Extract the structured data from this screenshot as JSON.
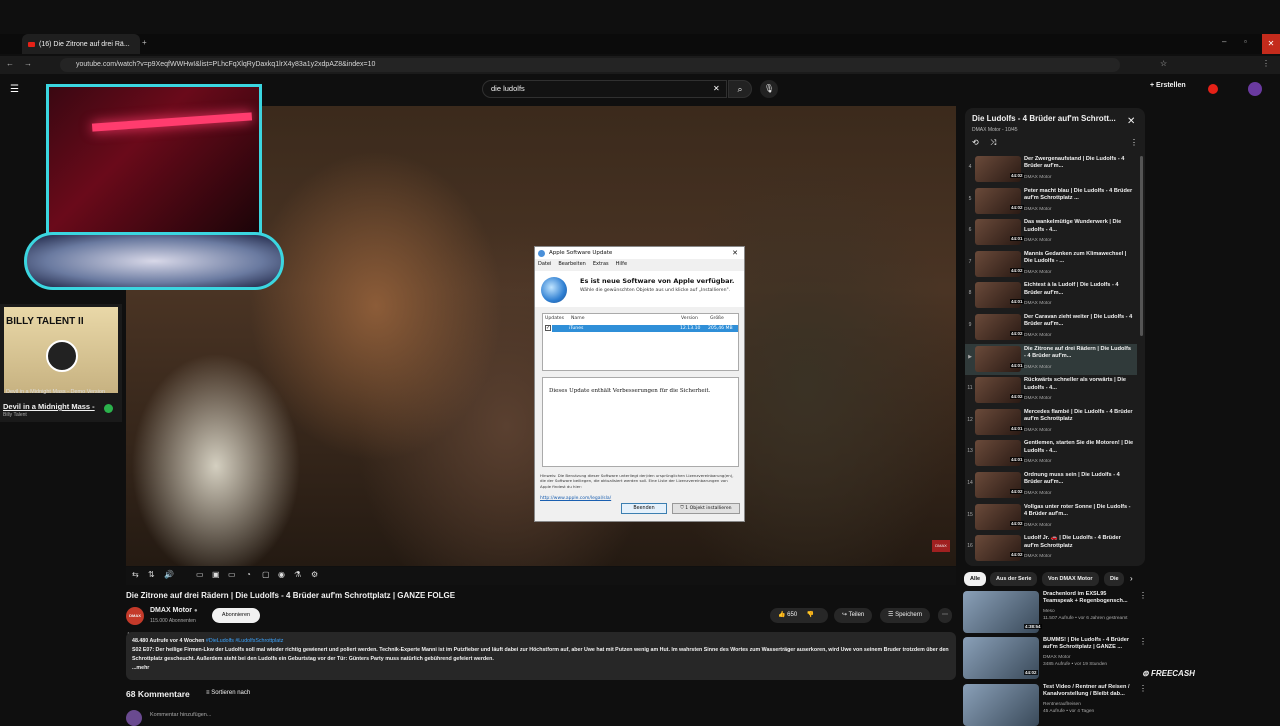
{
  "browser": {
    "tab_title": "(16) Die Zitrone auf drei Rä...",
    "url": "youtube.com/watch?v=p9XeqfWWHwI&list=PLhcFqXlqRyDaxkq1lrX4y83a1y2xdpAZ8&index=10"
  },
  "header": {
    "search_value": "die ludolfs",
    "create_label": "Erstellen"
  },
  "album": {
    "art_title": "BILLY TALENT II",
    "caption": "Devil in a Midnight Mass - Demo Version",
    "song": "Devil in a Midnight Mass -",
    "artist": "Billy Talent"
  },
  "dialog": {
    "title": "Apple Software Update",
    "menu": [
      "Datei",
      "Bearbeiten",
      "Extras",
      "Hilfe"
    ],
    "heading": "Es ist neue Software von Apple verfügbar.",
    "subheading": "Wähle die gewünschten Objekte aus und klicke auf „Installieren\".",
    "col_updates": "Updates",
    "col_name": "Name",
    "col_version": "Version",
    "col_size": "Größe",
    "item_name": "iTunes",
    "item_version": "12.13.10",
    "item_size": "205,46 MB",
    "description": "Dieses Update enthält Verbesserungen für die Sicherheit.",
    "fineprint": "Hinweis: Die Benutzung dieser Software unterliegt der/den ursprünglichen Lizenzvereinbarung(en), die der Software beiliegen, die aktualisiert werden soll. Eine Liste der Lizenzvereinbarungen von Apple findest du hier:",
    "link": "http://www.apple.com/legal/sla/",
    "quit_label": "Beenden",
    "install_label": "1 Objekt installieren"
  },
  "video": {
    "title": "Die Zitrone auf drei Rädern | Die Ludolfs - 4 Brüder auf'm Schrottplatz | GANZE FOLGE",
    "channel": "DMAX Motor",
    "subscribers": "115.000 Abonnenten",
    "subscribe_label": "Abonnieren",
    "avatar_text": "DMAX MOTOR",
    "likes": "650",
    "share_label": "Teilen",
    "save_label": "Speichern",
    "desc_meta": "48.480 Aufrufe  vor 4 Wochen",
    "desc_tags": "#DieLudolfs #LudolfsSchrottplatz",
    "desc_text": "S02 E07: Der heilige Firmen-Lkw der Ludolfs soll mal wieder richtig gewienert und poliert werden. Technik-Experte Manni ist im Putzfieber und läuft dabei zur Höchstform auf, aber Uwe hat mit Putzen wenig am Hut. Im wahrsten Sinne des Wortes zum Wasserträger auserkoren, wird Uwe von seinem Bruder trotzdem über den Schrottplatz gescheucht. Außerdem steht bei den Ludolfs ein Geburtstag vor der Tür: Günters Party muss natürlich gebührend gefeiert werden.",
    "desc_more": "...mehr",
    "comments_count": "68 Kommentare",
    "sort_label": "Sortieren nach",
    "add_comment": "Kommentar hinzufügen..."
  },
  "playlist": {
    "title": "Die Ludolfs - 4 Brüder auf'm Schrott...",
    "subtitle": "DMAX Motor - 10/45",
    "items": [
      {
        "num": "4",
        "title": "Der Zwergenaufstand | Die Ludolfs - 4 Brüder auf'm...",
        "channel": "DMAX Motor",
        "duration": "44:02"
      },
      {
        "num": "5",
        "title": "Peter macht blau | Die Ludolfs - 4 Brüder auf'm Schrottplatz ...",
        "channel": "DMAX Motor",
        "duration": "44:02"
      },
      {
        "num": "6",
        "title": "Das wankelmütige Wunderwerk | Die Ludolfs - 4...",
        "channel": "DMAX Motor",
        "duration": "44:01"
      },
      {
        "num": "7",
        "title": "Mannis Gedanken zum Klimawechsel | Die Ludolfs - ...",
        "channel": "DMAX Motor",
        "duration": "44:02"
      },
      {
        "num": "8",
        "title": "Eichtest à la Ludolf | Die Ludolfs - 4 Brüder auf'm...",
        "channel": "DMAX Motor",
        "duration": "44:01"
      },
      {
        "num": "9",
        "title": "Der Caravan zieht weiter | Die Ludolfs - 4 Brüder auf'm...",
        "channel": "DMAX Motor",
        "duration": "44:02"
      },
      {
        "num": "▶",
        "title": "Die Zitrone auf drei Rädern | Die Ludolfs - 4 Brüder auf'm...",
        "channel": "DMAX Motor",
        "duration": "44:01"
      },
      {
        "num": "11",
        "title": "Rückwärts schneller als vorwärts | Die Ludolfs - 4...",
        "channel": "DMAX Motor",
        "duration": "44:02"
      },
      {
        "num": "12",
        "title": "Mercedes flambé | Die Ludolfs - 4 Brüder auf'm Schrottplatz",
        "channel": "DMAX Motor",
        "duration": "44:01"
      },
      {
        "num": "13",
        "title": "Gentlemen, starten Sie die Motoren! | Die Ludolfs - 4...",
        "channel": "DMAX Motor",
        "duration": "44:01"
      },
      {
        "num": "14",
        "title": "Ordnung muss sein | Die Ludolfs - 4 Brüder auf'm...",
        "channel": "DMAX Motor",
        "duration": "44:02"
      },
      {
        "num": "15",
        "title": "Vollgas unter roter Sonne | Die Ludolfs - 4 Brüder auf'm...",
        "channel": "DMAX Motor",
        "duration": "44:02"
      },
      {
        "num": "16",
        "title": "Ludolf Jr. 🚗 | Die Ludolfs - 4 Brüder auf'm Schrottplatz",
        "channel": "DMAX Motor",
        "duration": "44:02"
      }
    ]
  },
  "chips": [
    "Alle",
    "Aus der Serie",
    "Von DMAX Motor",
    "Die"
  ],
  "recommendations": [
    {
      "title": "Drachenlord im EXSL95 Teamspeak + Regenbogensch...",
      "channel": "Meso",
      "meta": "11.507 Aufrufe • vor 6 Jahren gestreamt",
      "duration": "4:38:54"
    },
    {
      "title": "BUMMS! | Die Ludolfs - 4 Brüder auf'm Schrottplatz | GANZE ...",
      "channel": "DMAX Motor",
      "meta": "3485 Aufrufe • vor 19 Stunden",
      "duration": "44:02"
    },
    {
      "title": "Test Video / Rentner auf Reisen / Kanalvorstellung / Bleibt dab...",
      "channel": "Rentnerauflreisen",
      "meta": "45 Aufrufe • vor 4 Tagen",
      "duration": ""
    }
  ],
  "watermark": "FREECASH"
}
